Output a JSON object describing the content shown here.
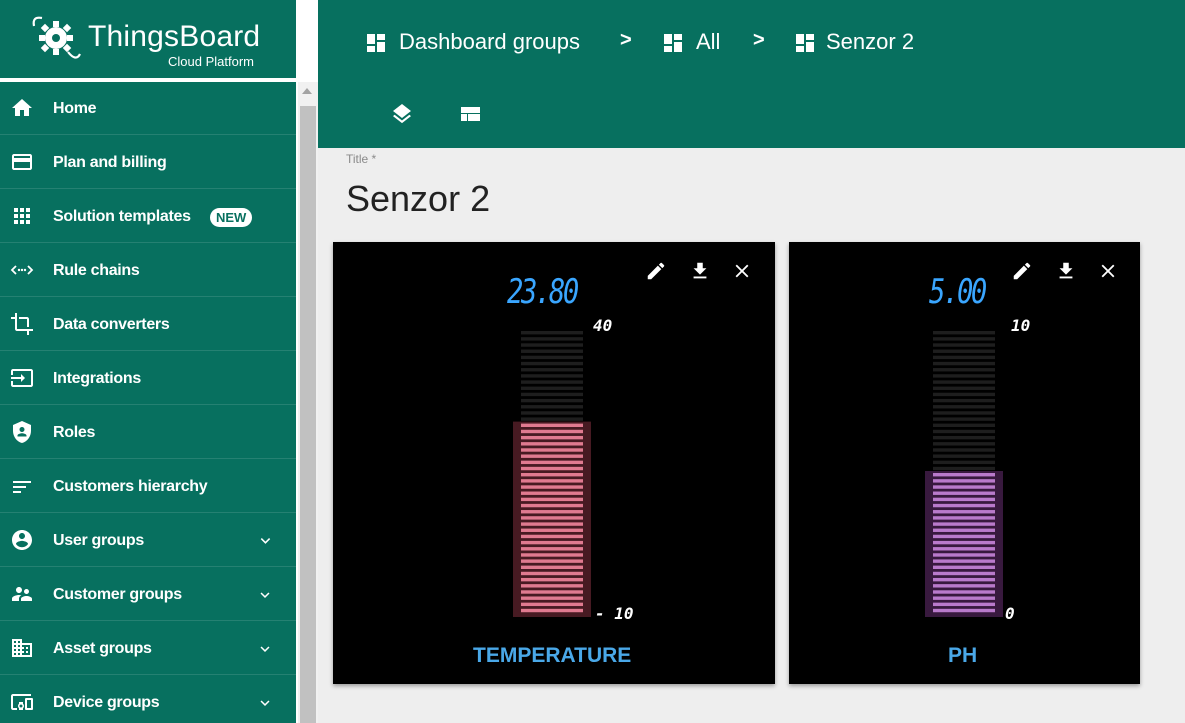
{
  "logo": {
    "name": "ThingsBoard",
    "subtitle": "Cloud Platform"
  },
  "sidebar": {
    "items": [
      {
        "label": "Home",
        "icon": "home-icon"
      },
      {
        "label": "Plan and billing",
        "icon": "credit-card-icon"
      },
      {
        "label": "Solution templates",
        "icon": "apps-grid-icon",
        "badge": "NEW"
      },
      {
        "label": "Rule chains",
        "icon": "code-arrows-icon"
      },
      {
        "label": "Data converters",
        "icon": "crop-icon"
      },
      {
        "label": "Integrations",
        "icon": "input-icon"
      },
      {
        "label": "Roles",
        "icon": "shield-icon"
      },
      {
        "label": "Customers hierarchy",
        "icon": "sort-lines-icon"
      },
      {
        "label": "User groups",
        "icon": "account-circle-icon",
        "expandable": true
      },
      {
        "label": "Customer groups",
        "icon": "supervisor-icon",
        "expandable": true
      },
      {
        "label": "Asset groups",
        "icon": "domain-icon",
        "expandable": true
      },
      {
        "label": "Device groups",
        "icon": "devices-icon",
        "expandable": true
      }
    ]
  },
  "breadcrumb": [
    {
      "label": "Dashboard groups",
      "icon": "dashboard-icon"
    },
    {
      "label": "All",
      "icon": "dashboard-icon"
    },
    {
      "label": "Senzor 2",
      "icon": "dashboard-icon"
    }
  ],
  "breadcrumb_separator": ">",
  "toolbar": {
    "icons": [
      "layers-icon",
      "view-compact-icon"
    ]
  },
  "title": {
    "label": "Title *",
    "value": "Senzor 2"
  },
  "widgets": [
    {
      "label": "TEMPERATURE",
      "value": 23.8,
      "value_text": "23.80",
      "max_label": "40",
      "min_label": "- 10",
      "min": -10,
      "max": 40,
      "bar_color": "#e07a90",
      "glow_color": "#ff5c7a",
      "actions": [
        "edit-icon",
        "download-icon",
        "close-icon"
      ]
    },
    {
      "label": "PH",
      "value": 5.0,
      "value_text": "5.00",
      "max_label": "10",
      "min_label": "0",
      "min": 0,
      "max": 10,
      "bar_color": "#b97acb",
      "glow_color": "#c85ae0",
      "actions": [
        "edit-icon",
        "download-icon",
        "close-icon"
      ]
    }
  ],
  "colors": {
    "primary": "#07705f",
    "value_text": "#3aa6ff",
    "widget_label": "#4aa8e8"
  }
}
